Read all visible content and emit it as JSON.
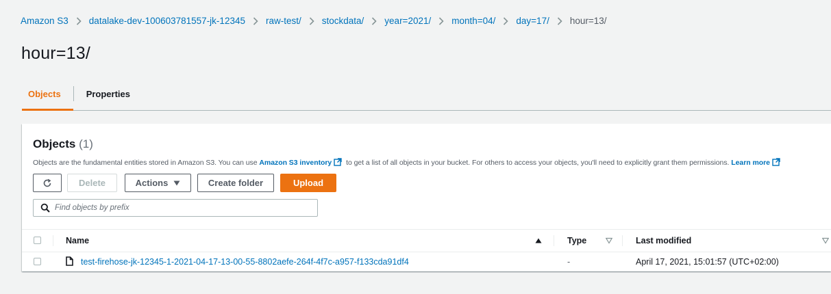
{
  "breadcrumb": {
    "items": [
      "Amazon S3",
      "datalake-dev-100603781557-jk-12345",
      "raw-test/",
      "stockdata/",
      "year=2021/",
      "month=04/",
      "day=17/"
    ],
    "current": "hour=13/"
  },
  "page": {
    "title": "hour=13/"
  },
  "tabs": [
    {
      "label": "Objects",
      "active": true
    },
    {
      "label": "Properties",
      "active": false
    }
  ],
  "objects_panel": {
    "heading": "Objects",
    "count": "(1)",
    "description_1": "Objects are the fundamental entities stored in Amazon S3. You can use ",
    "inventory_link": "Amazon S3 inventory",
    "description_2": " to get a list of all objects in your bucket. For others to access your objects, you'll need to explicitly grant them permissions. ",
    "learn_more": "Learn more"
  },
  "toolbar": {
    "refresh_icon": "refresh-icon",
    "delete_label": "Delete",
    "actions_label": "Actions",
    "create_folder_label": "Create folder",
    "upload_label": "Upload"
  },
  "search": {
    "placeholder": "Find objects by prefix"
  },
  "table": {
    "columns": [
      "Name",
      "Type",
      "Last modified"
    ],
    "rows": [
      {
        "name": "test-firehose-jk-12345-1-2021-04-17-13-00-55-8802aefe-264f-4f7c-a957-f133cda91df4",
        "type": "-",
        "last_modified": "April 17, 2021, 15:01:57 (UTC+02:00)"
      }
    ]
  },
  "colors": {
    "accent": "#ec7211",
    "link": "#0073bb",
    "background": "#f2f3f3"
  }
}
